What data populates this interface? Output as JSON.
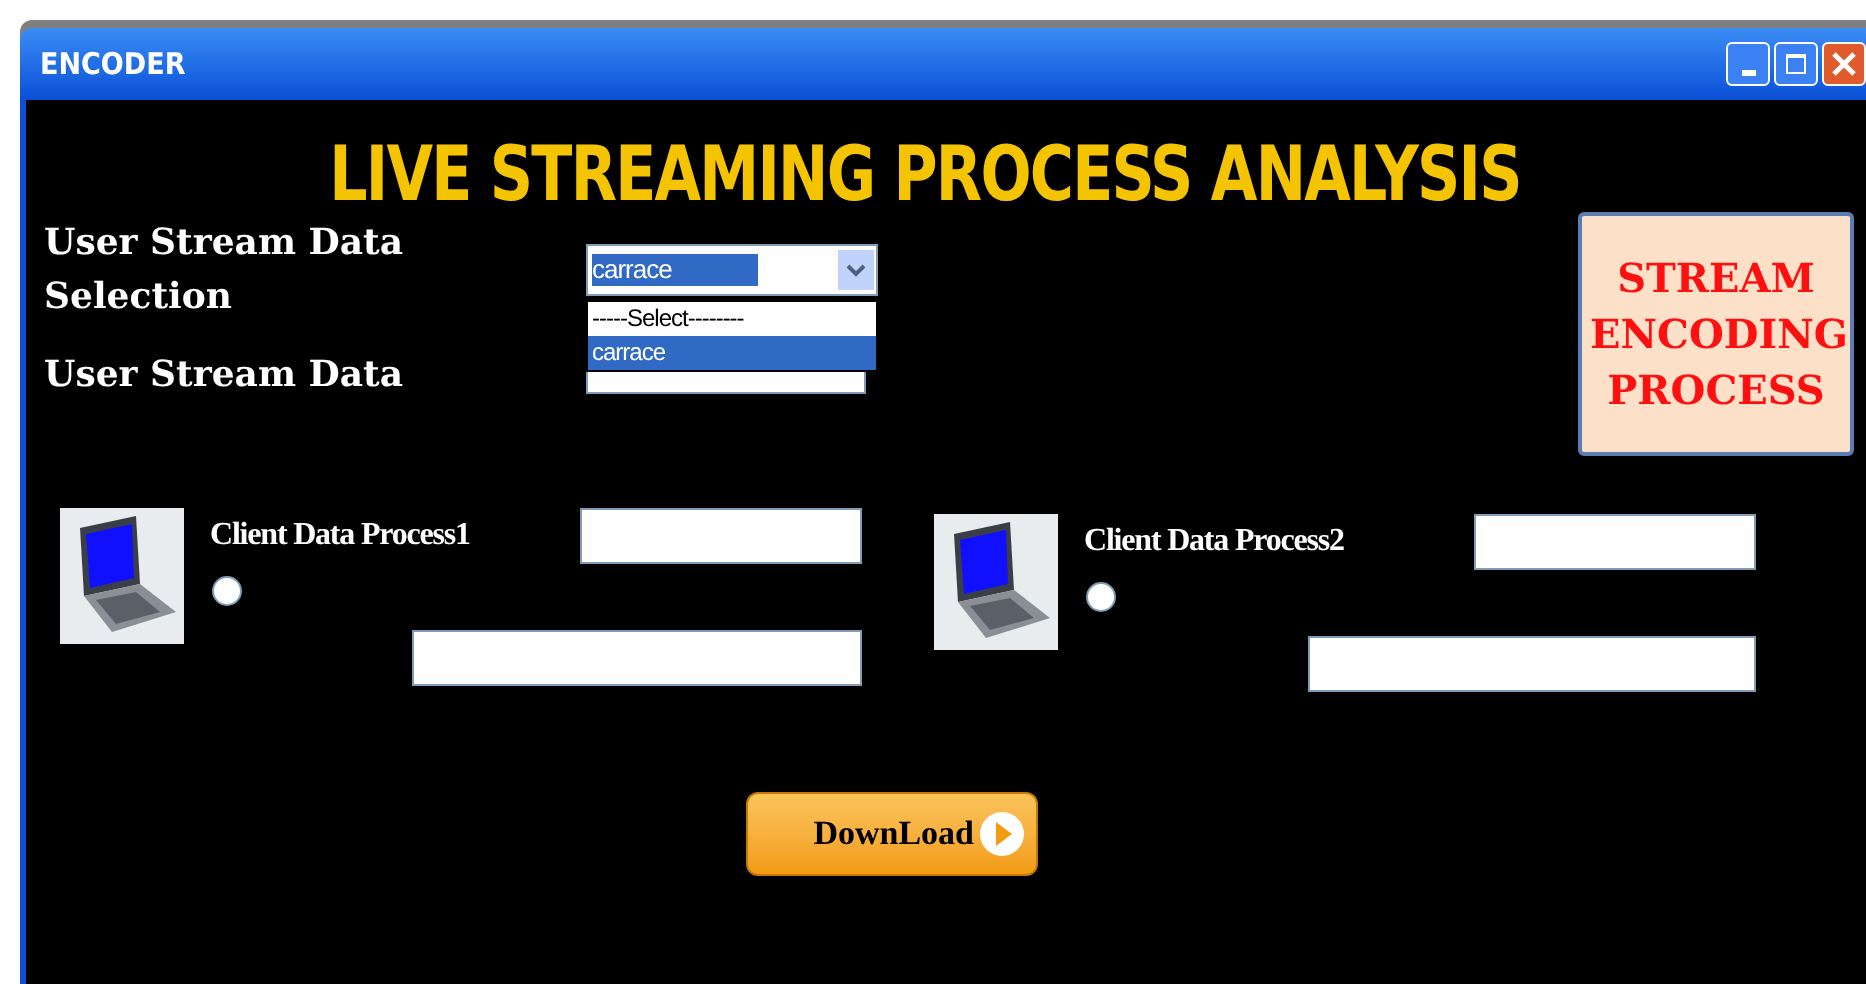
{
  "window": {
    "title": "ENCODER"
  },
  "heading": "LIVE STREAMING PROCESS ANALYSIS",
  "selection": {
    "label": "User Stream Data Selection",
    "value": "carrace",
    "options": [
      {
        "label": "-----Select--------",
        "selected": false
      },
      {
        "label": "carrace",
        "selected": true
      }
    ]
  },
  "stream_data": {
    "label": "User Stream Data"
  },
  "encode_button": "STREAM ENCODING PROCESS",
  "clients": [
    {
      "label": "Client Data Process1",
      "selected": false
    },
    {
      "label": "Client Data Process2",
      "selected": false
    }
  ],
  "download_button": "DownLoad"
}
